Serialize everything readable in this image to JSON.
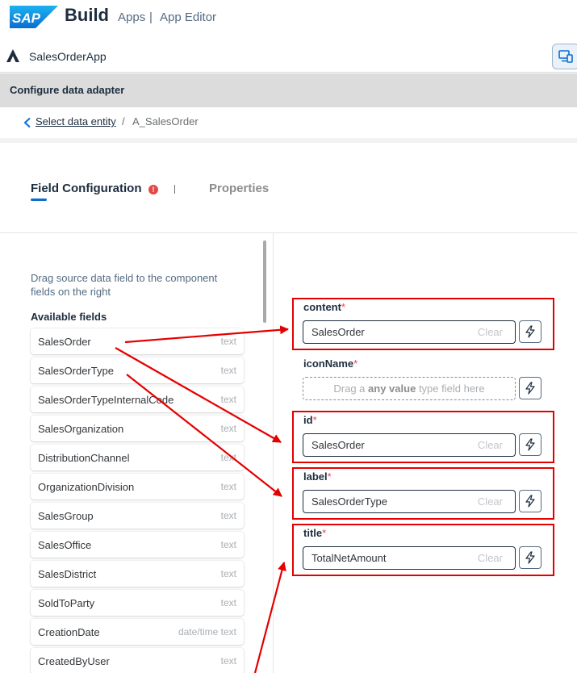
{
  "brand": {
    "logo_text": "SAP",
    "product": "Build",
    "section": "Apps",
    "separator": "|",
    "editor": "App Editor"
  },
  "app": {
    "name": "SalesOrderApp",
    "device_button_icon": "device-preview-icon"
  },
  "panel": {
    "title": "Configure data adapter"
  },
  "breadcrumb": {
    "back_icon": "chevron-left-icon",
    "link": "Select data entity",
    "separator": "/",
    "current": "A_SalesOrder"
  },
  "tabs": [
    {
      "label": "Field Configuration",
      "selected": true,
      "info_icon": "!"
    },
    {
      "label": "Properties",
      "selected": false
    }
  ],
  "left": {
    "hint": "Drag source data field to the component fields on the right",
    "title": "Available fields",
    "fields": [
      {
        "name": "SalesOrder",
        "type": "text"
      },
      {
        "name": "SalesOrderType",
        "type": "text"
      },
      {
        "name": "SalesOrderTypeInternalCode",
        "type": "text"
      },
      {
        "name": "SalesOrganization",
        "type": "text"
      },
      {
        "name": "DistributionChannel",
        "type": "text"
      },
      {
        "name": "OrganizationDivision",
        "type": "text"
      },
      {
        "name": "SalesGroup",
        "type": "text"
      },
      {
        "name": "SalesOffice",
        "type": "text"
      },
      {
        "name": "SalesDistrict",
        "type": "text"
      },
      {
        "name": "SoldToParty",
        "type": "text"
      },
      {
        "name": "CreationDate",
        "type": "date/time text"
      },
      {
        "name": "CreatedByUser",
        "type": "text"
      }
    ]
  },
  "right": {
    "required_mark": "*",
    "clear_label": "Clear",
    "dropzone": {
      "prefix": "Drag a",
      "emphasis": "any value",
      "suffix": "type field here"
    },
    "groups": [
      {
        "label": "content",
        "value": "SalesOrder",
        "filled": true,
        "highlighted": true
      },
      {
        "label": "iconName",
        "value": "",
        "filled": false,
        "highlighted": false
      },
      {
        "label": "id",
        "value": "SalesOrder",
        "filled": true,
        "highlighted": true
      },
      {
        "label": "label",
        "value": "SalesOrderType",
        "filled": true,
        "highlighted": true
      },
      {
        "label": "title",
        "value": "TotalNetAmount",
        "filled": true,
        "highlighted": true
      }
    ]
  },
  "colors": {
    "accent": "#0a6ed1",
    "annotation": "#e50000",
    "required": "#e34948"
  }
}
